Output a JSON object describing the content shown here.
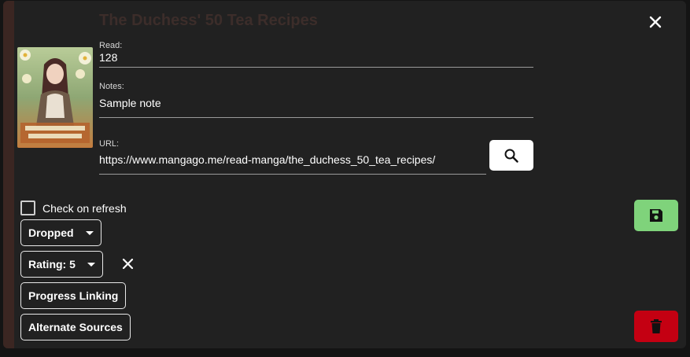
{
  "dialog": {
    "title": "The Duchess' 50 Tea Recipes",
    "close_icon": "close-icon"
  },
  "fields": {
    "read": {
      "label": "Read:",
      "value": "128"
    },
    "notes": {
      "label": "Notes:",
      "value": "Sample note"
    },
    "url": {
      "label": "URL:",
      "value": "https://www.mangago.me/read-manga/the_duchess_50_tea_recipes/"
    }
  },
  "search_button": {
    "icon": "search-icon"
  },
  "check_on_refresh": {
    "label": "Check on refresh",
    "checked": false
  },
  "status_dropdown": {
    "label": "Dropped"
  },
  "rating_dropdown": {
    "label": "Rating: 5"
  },
  "progress_linking": {
    "label": "Progress Linking"
  },
  "alternate_sources": {
    "label": "Alternate Sources"
  },
  "save_button": {
    "icon": "save-icon",
    "color": "#7fd37b"
  },
  "delete_button": {
    "icon": "trash-icon",
    "color": "#c40012"
  },
  "colors": {
    "background": "#212121",
    "accent": "#3b2622"
  }
}
